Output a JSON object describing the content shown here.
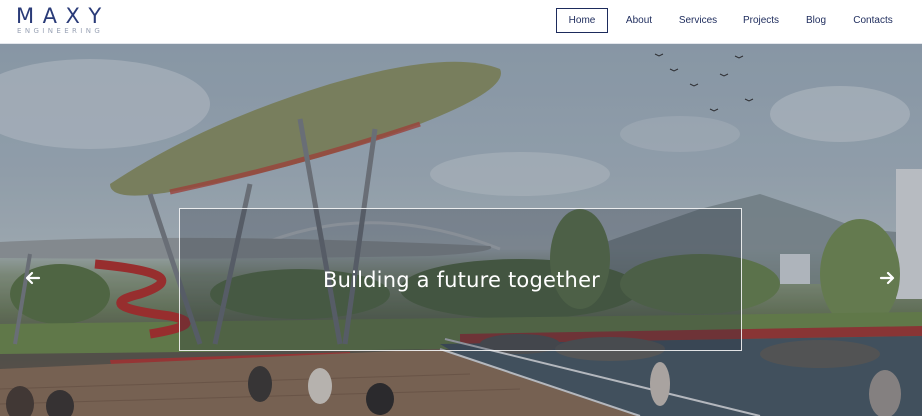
{
  "brand": {
    "name": "MAXY",
    "tagline": "ENGINEERING"
  },
  "nav": {
    "items": [
      {
        "label": "Home",
        "active": true
      },
      {
        "label": "About",
        "active": false
      },
      {
        "label": "Services",
        "active": false
      },
      {
        "label": "Projects",
        "active": false
      },
      {
        "label": "Blog",
        "active": false
      },
      {
        "label": "Contacts",
        "active": false
      }
    ]
  },
  "hero": {
    "caption": "Building a future together",
    "prev_icon": "arrow-left-icon",
    "next_icon": "arrow-right-icon"
  },
  "colors": {
    "brand": "#2a3b78",
    "nav_text": "#1d2b5c",
    "caption_text": "#ffffff"
  }
}
